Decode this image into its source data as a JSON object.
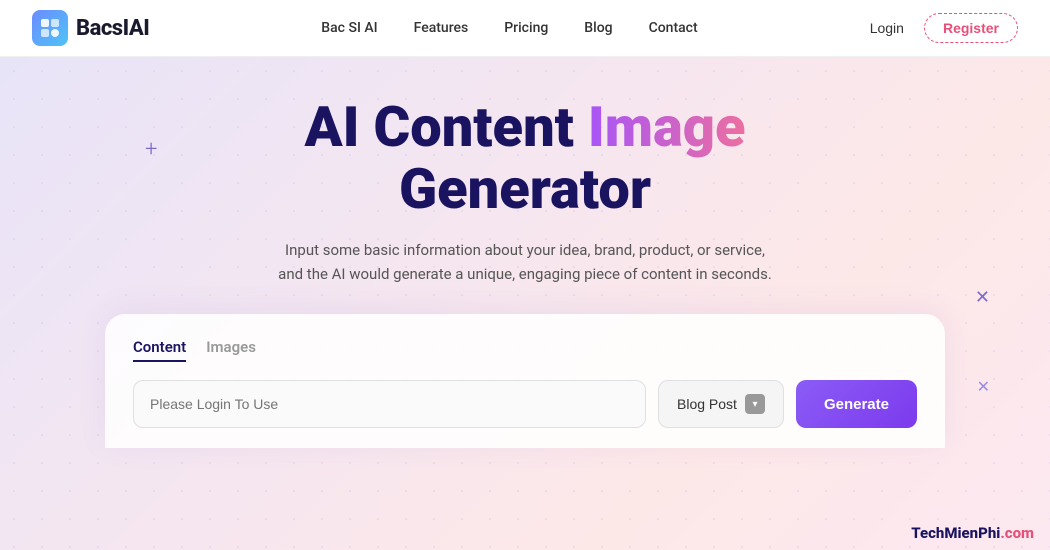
{
  "navbar": {
    "logo_text": "BacsIAI",
    "links": [
      {
        "id": "bac-si-ai",
        "label": "Bac SI AI"
      },
      {
        "id": "features",
        "label": "Features"
      },
      {
        "id": "pricing",
        "label": "Pricing"
      },
      {
        "id": "blog",
        "label": "Blog"
      },
      {
        "id": "contact",
        "label": "Contact"
      }
    ],
    "login_label": "Login",
    "register_label": "Register"
  },
  "hero": {
    "title_part1": "AI Content ",
    "title_image": "Image",
    "title_line2": "Generator",
    "subtitle_line1": "Input some basic information about your idea, brand, product, or service,",
    "subtitle_line2": "and the AI would generate a unique, engaging piece of content in seconds."
  },
  "card": {
    "tab_content": "Content",
    "tab_images": "Images",
    "input_placeholder": "Please Login To Use",
    "dropdown_label": "Blog Post",
    "generate_label": "Generate"
  },
  "watermark": {
    "part1": "TechMienPhi",
    "part2": ".com"
  },
  "decorations": {
    "plus": "+",
    "x1": "✕",
    "x2": "✕"
  }
}
